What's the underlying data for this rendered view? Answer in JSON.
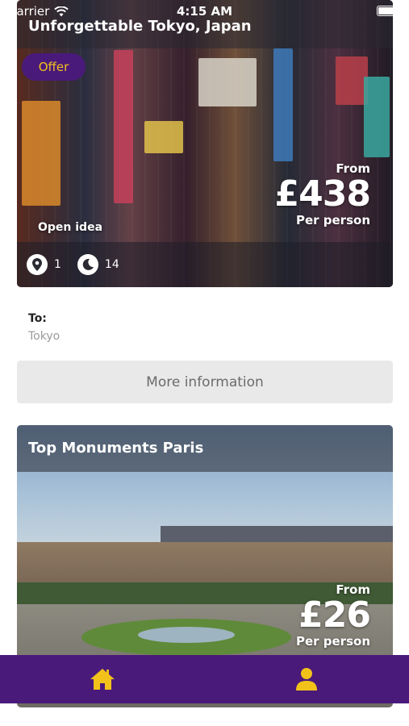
{
  "status_bar": {
    "carrier": "Carrier",
    "time": "4:15 AM"
  },
  "colors": {
    "brand_purple": "#4a1a7a",
    "accent_yellow": "#f2c21b",
    "button_grey": "#e9e9e9"
  },
  "offers": [
    {
      "title": "Unforgettable Tokyo, Japan",
      "badge": "Offer",
      "price_from": "From",
      "price": "£438",
      "price_per": "Per person",
      "open_idea": "Open idea",
      "stats": [
        {
          "icon": "location-pin-icon",
          "value": "1"
        },
        {
          "icon": "moon-icon",
          "value": "14"
        }
      ],
      "to_label": "To:",
      "to_value": "Tokyo",
      "more_button": "More information"
    },
    {
      "title": "Top Monuments Paris",
      "price_from": "From",
      "price": "£26",
      "price_per": "Per person"
    }
  ],
  "tab_bar": {
    "tabs": [
      {
        "icon": "home-icon"
      },
      {
        "icon": "profile-icon"
      }
    ]
  }
}
